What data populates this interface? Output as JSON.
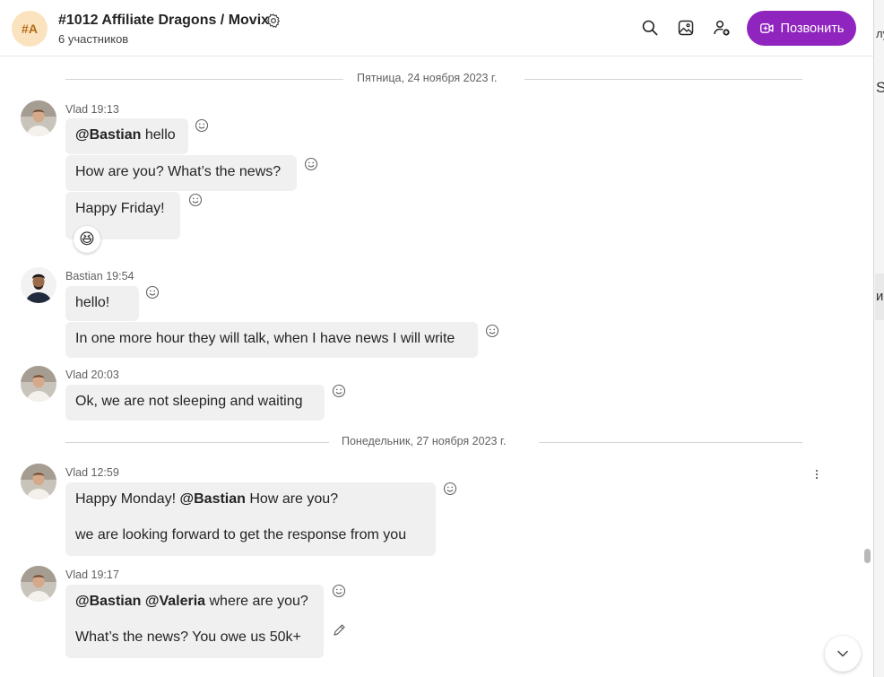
{
  "header": {
    "avatar_initials": "#A",
    "title": "#1012 Affiliate Dragons / Movix",
    "subtitle": "6 участников",
    "call_label": "Позвонить",
    "icons": [
      "search-icon",
      "gallery-icon",
      "add-people-icon",
      "video-call-icon",
      "gear-icon"
    ]
  },
  "side_panel": {
    "fragments": [
      "лу",
      "SF",
      "и"
    ]
  },
  "dividers": [
    {
      "label": "Пятница, 24 ноября 2023 г."
    },
    {
      "label": "Понедельник, 27 ноября 2023 г."
    }
  ],
  "messages": [
    {
      "author": "Vlad",
      "time": "19:13",
      "bubbles": [
        {
          "mention": "@Bastian",
          "text": " hello"
        },
        {
          "text": "How are you? What’s the news?"
        },
        {
          "text": "Happy Friday!",
          "reaction": "😆"
        }
      ]
    },
    {
      "author": "Bastian",
      "time": "19:54",
      "bubbles": [
        {
          "text": "hello!"
        },
        {
          "text": "In one more hour they will talk, when I have news I will write"
        }
      ]
    },
    {
      "author": "Vlad",
      "time": "20:03",
      "bubbles": [
        {
          "text": "Ok, we are not sleeping and waiting"
        }
      ]
    },
    {
      "author": "Vlad",
      "time": "12:59",
      "bubbles": [
        {
          "pre": "Happy Monday! ",
          "mention": "@Bastian",
          "post": " How are you?",
          "line2": "we are looking forward to get the response from you"
        }
      ]
    },
    {
      "author": "Vlad",
      "time": "19:17",
      "bubbles": [
        {
          "mention": "@Bastian @Valeria",
          "post": " where are you?",
          "line2": "What’s the news? You owe us 50k+"
        }
      ]
    }
  ],
  "colors": {
    "accent": "#8f24be",
    "bubble": "#f0f0f0",
    "avatar_bg": "#fbe3bf"
  }
}
